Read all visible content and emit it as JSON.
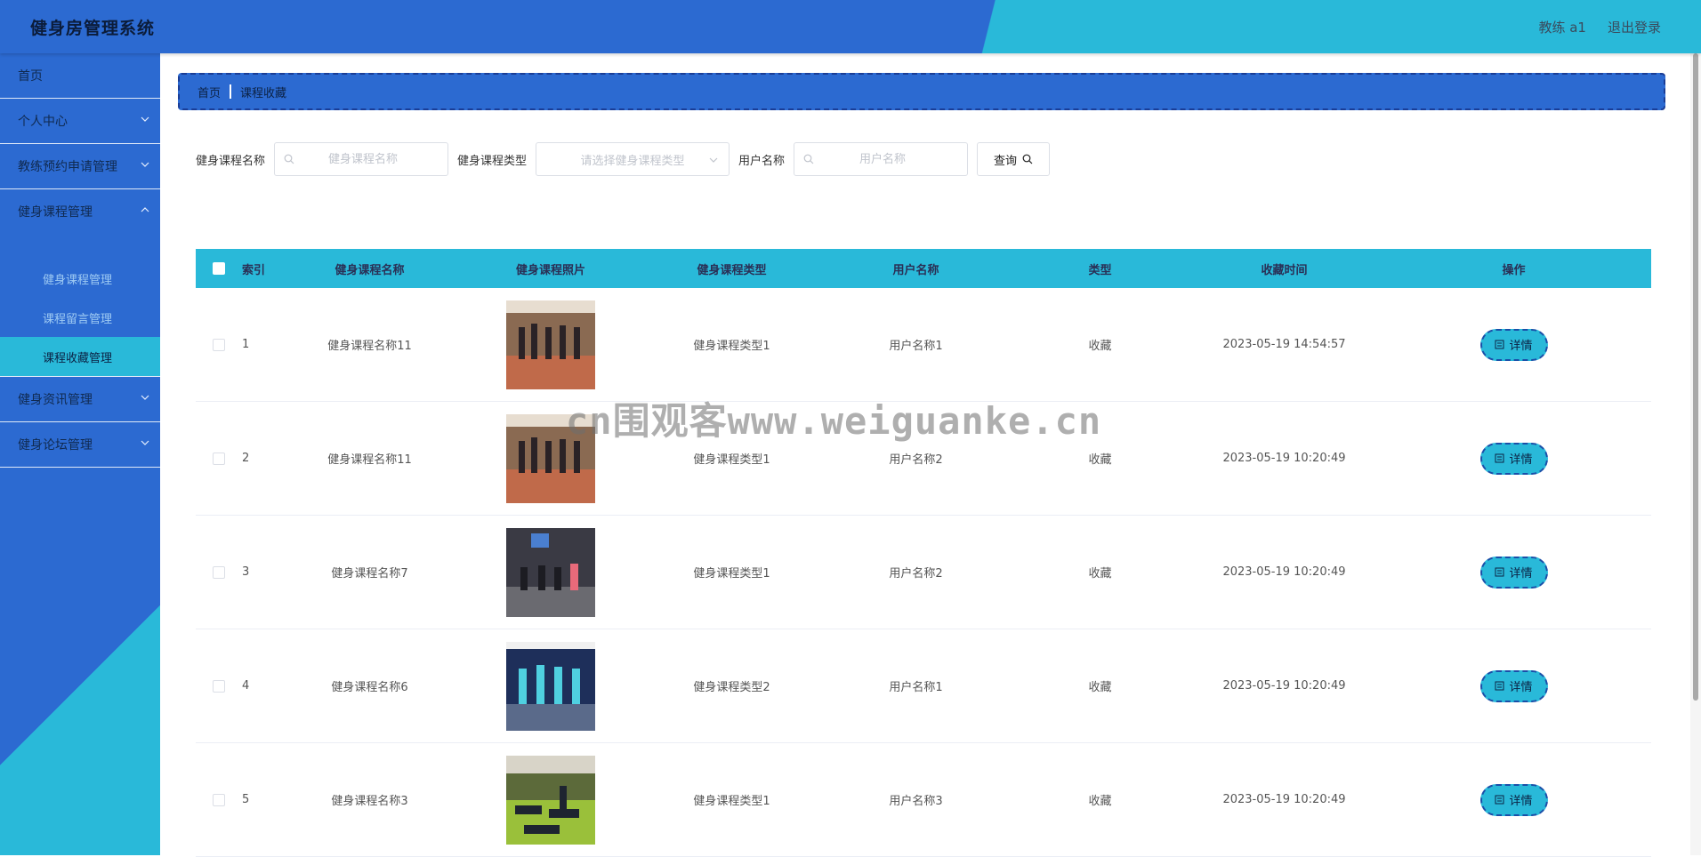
{
  "header": {
    "app_title": "健身房管理系统",
    "user_label": "教练 a1",
    "logout_label": "退出登录"
  },
  "sidebar": {
    "items": [
      {
        "label": "首页"
      },
      {
        "label": "个人中心"
      },
      {
        "label": "教练预约申请管理"
      },
      {
        "label": "健身课程管理"
      },
      {
        "label": "健身资讯管理"
      },
      {
        "label": "健身论坛管理"
      }
    ],
    "subitems": [
      {
        "label": "健身课程管理"
      },
      {
        "label": "课程留言管理"
      },
      {
        "label": "课程收藏管理"
      }
    ]
  },
  "breadcrumb": {
    "home": "首页",
    "current": "课程收藏"
  },
  "search": {
    "course_name_label": "健身课程名称",
    "course_name_placeholder": "健身课程名称",
    "course_type_label": "健身课程类型",
    "course_type_placeholder": "请选择健身课程类型",
    "user_name_label": "用户名称",
    "user_name_placeholder": "用户名称",
    "query_button": "查询"
  },
  "table": {
    "headers": [
      "索引",
      "健身课程名称",
      "健身课程照片",
      "健身课程类型",
      "用户名称",
      "类型",
      "收藏时间",
      "操作"
    ],
    "detail_label": "详情",
    "rows": [
      {
        "index": "1",
        "name": "健身课程名称11",
        "type": "健身课程类型1",
        "user": "用户名称1",
        "kind": "收藏",
        "time": "2023-05-19 14:54:57"
      },
      {
        "index": "2",
        "name": "健身课程名称11",
        "type": "健身课程类型1",
        "user": "用户名称2",
        "kind": "收藏",
        "time": "2023-05-19 10:20:49"
      },
      {
        "index": "3",
        "name": "健身课程名称7",
        "type": "健身课程类型1",
        "user": "用户名称2",
        "kind": "收藏",
        "time": "2023-05-19 10:20:49"
      },
      {
        "index": "4",
        "name": "健身课程名称6",
        "type": "健身课程类型2",
        "user": "用户名称1",
        "kind": "收藏",
        "time": "2023-05-19 10:20:49"
      },
      {
        "index": "5",
        "name": "健身课程名称3",
        "type": "健身课程类型1",
        "user": "用户名称3",
        "kind": "收藏",
        "time": "2023-05-19 10:20:49"
      }
    ]
  },
  "watermark": "cn围观客www.weiguanke.cn",
  "colors": {
    "primary": "#2c6ad1",
    "accent": "#29b9d9"
  }
}
